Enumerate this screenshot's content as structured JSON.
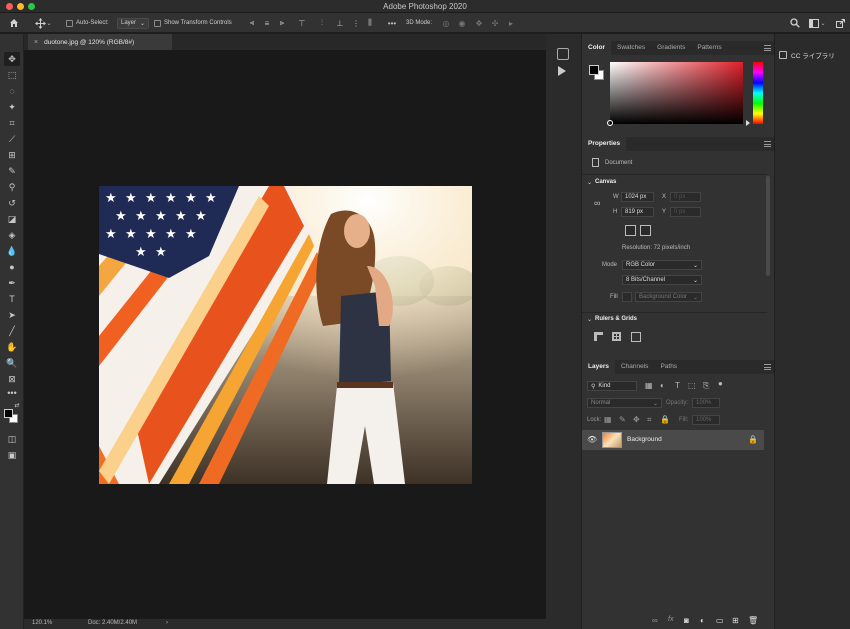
{
  "app": {
    "title": "Adobe Photoshop 2020",
    "traffic_colors": [
      "#fd5f57",
      "#febb2e",
      "#29c940"
    ]
  },
  "options_bar": {
    "auto_select_label": "Auto-Select:",
    "auto_select_value": "Layer",
    "transform_label": "Show Transform Controls",
    "three_d_label": "3D Mode:"
  },
  "document": {
    "tab_label": "duotone.jpg @ 120% (RGB/8#)",
    "close_glyph": "×"
  },
  "status": {
    "zoom": "120.1%",
    "doc_info": "Doc: 2.40M/2.40M"
  },
  "color_panel": {
    "tabs": [
      "Color",
      "Swatches",
      "Gradients",
      "Patterns"
    ],
    "active_tab": "Color"
  },
  "properties": {
    "tab_label": "Properties",
    "doc_label": "Document",
    "canvas_heading": "Canvas",
    "w_label": "W",
    "w_value": "1024 px",
    "h_label": "H",
    "h_value": "819 px",
    "x_label": "X",
    "x_value": "0 px",
    "y_label": "Y",
    "y_value": "0 px",
    "resolution": "Resolution: 72 pixels/inch",
    "mode_label": "Mode",
    "mode_value": "RGB Color",
    "bits_value": "8 Bits/Channel",
    "fill_label": "Fill",
    "fill_value": "Background Color",
    "rulers_heading": "Rulers & Grids"
  },
  "layers_panel": {
    "tabs": [
      "Layers",
      "Channels",
      "Paths"
    ],
    "active_tab": "Layers",
    "kind_label": "Kind",
    "blend_mode": "Normal",
    "opacity_label": "Opacity:",
    "opacity_value": "100%",
    "lock_label": "Lock:",
    "fill_label": "Fill:",
    "fill_value": "100%",
    "layers": [
      {
        "name": "Background",
        "visible": true,
        "locked": true
      }
    ]
  },
  "libraries": {
    "label": "CC ライブラリ"
  }
}
